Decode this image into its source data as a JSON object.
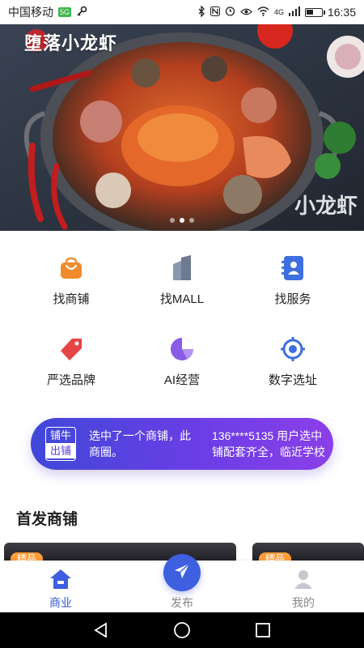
{
  "status_bar": {
    "carrier": "中国移动",
    "sim_icon": "sim-badge-icon",
    "sim_text": "5G",
    "network": "4G",
    "battery_level": 0.45,
    "time": "16:35"
  },
  "hero": {
    "brand": "堕落小龙虾",
    "watermark": "小龙虾",
    "active_slide": 1,
    "slide_count": 3
  },
  "menu": [
    {
      "label": "找商铺",
      "icon": "shopping-bag-icon",
      "color": "#f08a2c"
    },
    {
      "label": "找MALL",
      "icon": "building-icon",
      "color": "#7b8aa3"
    },
    {
      "label": "找服务",
      "icon": "contact-book-icon",
      "color": "#3e6fe0"
    },
    {
      "label": "严选品牌",
      "icon": "price-tag-icon",
      "color": "#e64545"
    },
    {
      "label": "AI经营",
      "icon": "pie-chart-icon",
      "color": "#8a5ce6"
    },
    {
      "label": "数字选址",
      "icon": "locate-target-icon",
      "color": "#3e6fe0"
    }
  ],
  "notice": {
    "badge_top": "铺牛",
    "badge_bottom": "出铺",
    "message_1_line1": "选中了一个商铺，此",
    "message_1_line2": "商圈。",
    "message_2_line1": "136****5135 用户选中",
    "message_2_line2": "铺配套齐全，临近学校"
  },
  "section": {
    "title": "首发商铺"
  },
  "cards": [
    {
      "tag": "精品"
    },
    {
      "tag": "精品"
    }
  ],
  "tabbar": {
    "items": [
      {
        "label": "商业",
        "icon": "home-icon",
        "active": true
      },
      {
        "label": "发布",
        "icon": "send-icon",
        "active": false
      },
      {
        "label": "我的",
        "icon": "user-icon",
        "active": false
      }
    ]
  },
  "colors": {
    "accent": "#2f55d4",
    "notice_start": "#3f48d8",
    "notice_end": "#8b3fe8",
    "tag": "#ff9d3a"
  }
}
